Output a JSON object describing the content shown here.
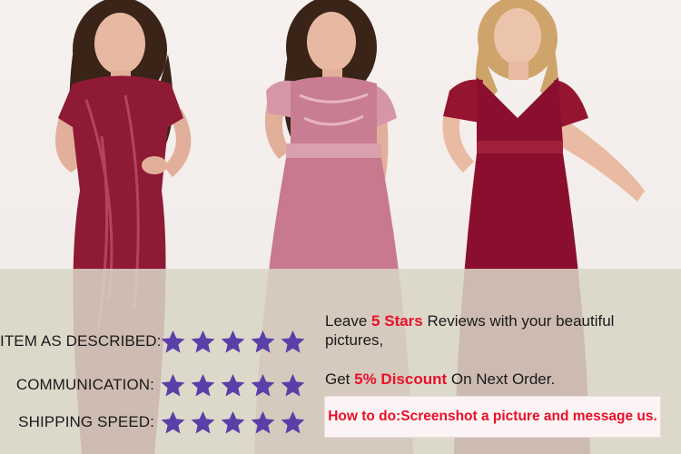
{
  "ratings": [
    {
      "label": "ITEM AS DESCRIBED:",
      "stars": 5
    },
    {
      "label": "COMMUNICATION:",
      "stars": 5
    },
    {
      "label": "SHIPPING SPEED:",
      "stars": 5
    }
  ],
  "promo": {
    "line1_pre": "Leave ",
    "line1_highlight": "5 Stars",
    "line1_post": " Reviews with your beautiful pictures,",
    "line2_pre": "Get ",
    "line2_highlight": "5% Discount",
    "line2_post": " On Next Order.",
    "howto": "How to do:Screenshot a picture and message us."
  },
  "colors": {
    "highlight": "#e8102a",
    "star": "#5a3fa8",
    "overlay": "#d8d6c6",
    "dress_burgundy": "#8e1a35",
    "dress_rose": "#c87d92",
    "dress_wine": "#8a0f2e"
  },
  "icons": [
    "star-icon"
  ]
}
